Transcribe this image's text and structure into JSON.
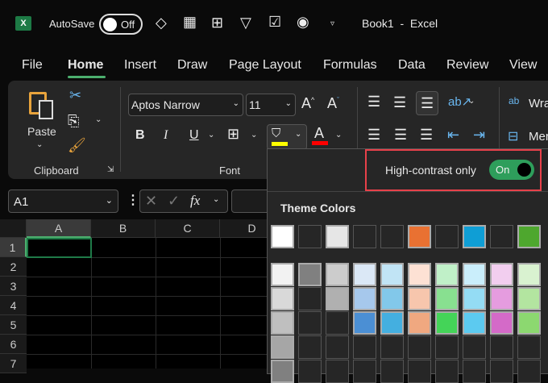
{
  "titlebar": {
    "autosave_label": "AutoSave",
    "autosave_state": "Off",
    "title": "Book1  -  Excel"
  },
  "tabs": [
    "File",
    "Home",
    "Insert",
    "Draw",
    "Page Layout",
    "Formulas",
    "Data",
    "Review",
    "View"
  ],
  "active_tab": "Home",
  "ribbon": {
    "paste": "Paste",
    "clipboard": "Clipboard",
    "font_group": "Font",
    "font_name": "Aptos Narrow",
    "font_size": "11",
    "bold": "B",
    "italic": "I",
    "underline": "U",
    "font_color_glyph": "A",
    "wrap": "Wra",
    "merge": "Mer",
    "fill_color": "#ffff00",
    "font_color": "#ff0000"
  },
  "formula_bar": {
    "name_box": "A1",
    "fx": "fx"
  },
  "grid": {
    "columns": [
      "A",
      "B",
      "C",
      "D"
    ],
    "rows": [
      "1",
      "2",
      "3",
      "4",
      "5",
      "6",
      "7"
    ],
    "selected": "A1"
  },
  "palette": {
    "high_contrast_label": "High-contrast only",
    "toggle_state": "On",
    "theme_colors_label": "Theme Colors",
    "theme_row": [
      "#ffffff",
      "",
      "#e6e6e6",
      "",
      "",
      "#e97132",
      "",
      "#0f9ed5",
      "",
      "#4ea72e"
    ],
    "shades": [
      [
        "#f2f2f2",
        "#d9d9d9",
        "#bfbfbf",
        "#a6a6a6",
        "#808080"
      ],
      [
        "#808080",
        "",
        "",
        "",
        ""
      ],
      [
        "#cccccc",
        "#b0b0b0",
        "",
        "",
        ""
      ],
      [
        "#dbe8f6",
        "#a6c8ec",
        "#4b8fd4",
        "",
        ""
      ],
      [
        "#c1e4f5",
        "#82c8ea",
        "#44afe0",
        "",
        ""
      ],
      [
        "#fde1d4",
        "#f7c6ad",
        "#f0a880",
        "",
        ""
      ],
      [
        "#c0f0c8",
        "#88e090",
        "#44d458",
        "",
        ""
      ],
      [
        "#caeefb",
        "#94dcf4",
        "#5ccaf0",
        "",
        ""
      ],
      [
        "#f2ceef",
        "#e59cdf",
        "#d46ac8",
        "",
        ""
      ],
      [
        "#d9f2d0",
        "#b3e5a0",
        "#8cd870",
        "",
        ""
      ]
    ]
  },
  "colors": {
    "accent": "#4caf6e",
    "highlight_border": "#e8414a",
    "toggle_on": "#2e9e5b"
  }
}
